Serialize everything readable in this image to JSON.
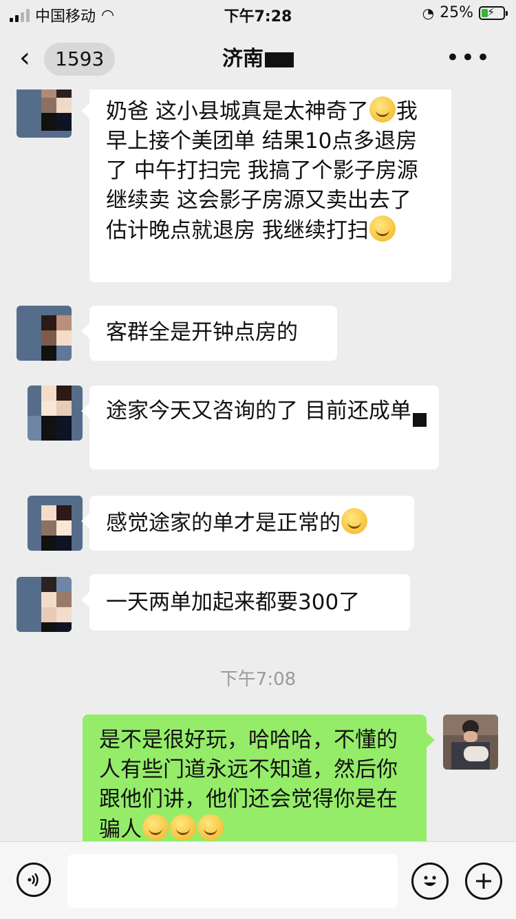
{
  "status_bar": {
    "carrier": "中国移动",
    "time": "下午7:28",
    "battery": "25%"
  },
  "nav": {
    "back_badge": "1593",
    "title": "济南",
    "more": "•••"
  },
  "messages": [
    {
      "side": "left",
      "text_before": "奶爸 这小县城真是太神奇了",
      "text_after": "我早上接个美团单 结果10点多退房了 中午打扫完 我搞了个影子房源继续卖 这会影子房源又卖出去了 估计晚点就退房 我继续打扫"
    },
    {
      "side": "left",
      "text": "客群全是开钟点房的"
    },
    {
      "side": "left",
      "text": "途家今天又咨询的了 目前还成单"
    },
    {
      "side": "left",
      "text": "感觉途家的单才是正常的"
    },
    {
      "side": "left",
      "text": "一天两单加起来都要300了"
    },
    {
      "side": "right",
      "text": "是不是很好玩，哈哈哈，不懂的人有些门道永远不知道，然后你跟他们讲，他们还会觉得你是在骗人"
    }
  ],
  "timestamp": "下午7:08",
  "input": {
    "placeholder": ""
  }
}
